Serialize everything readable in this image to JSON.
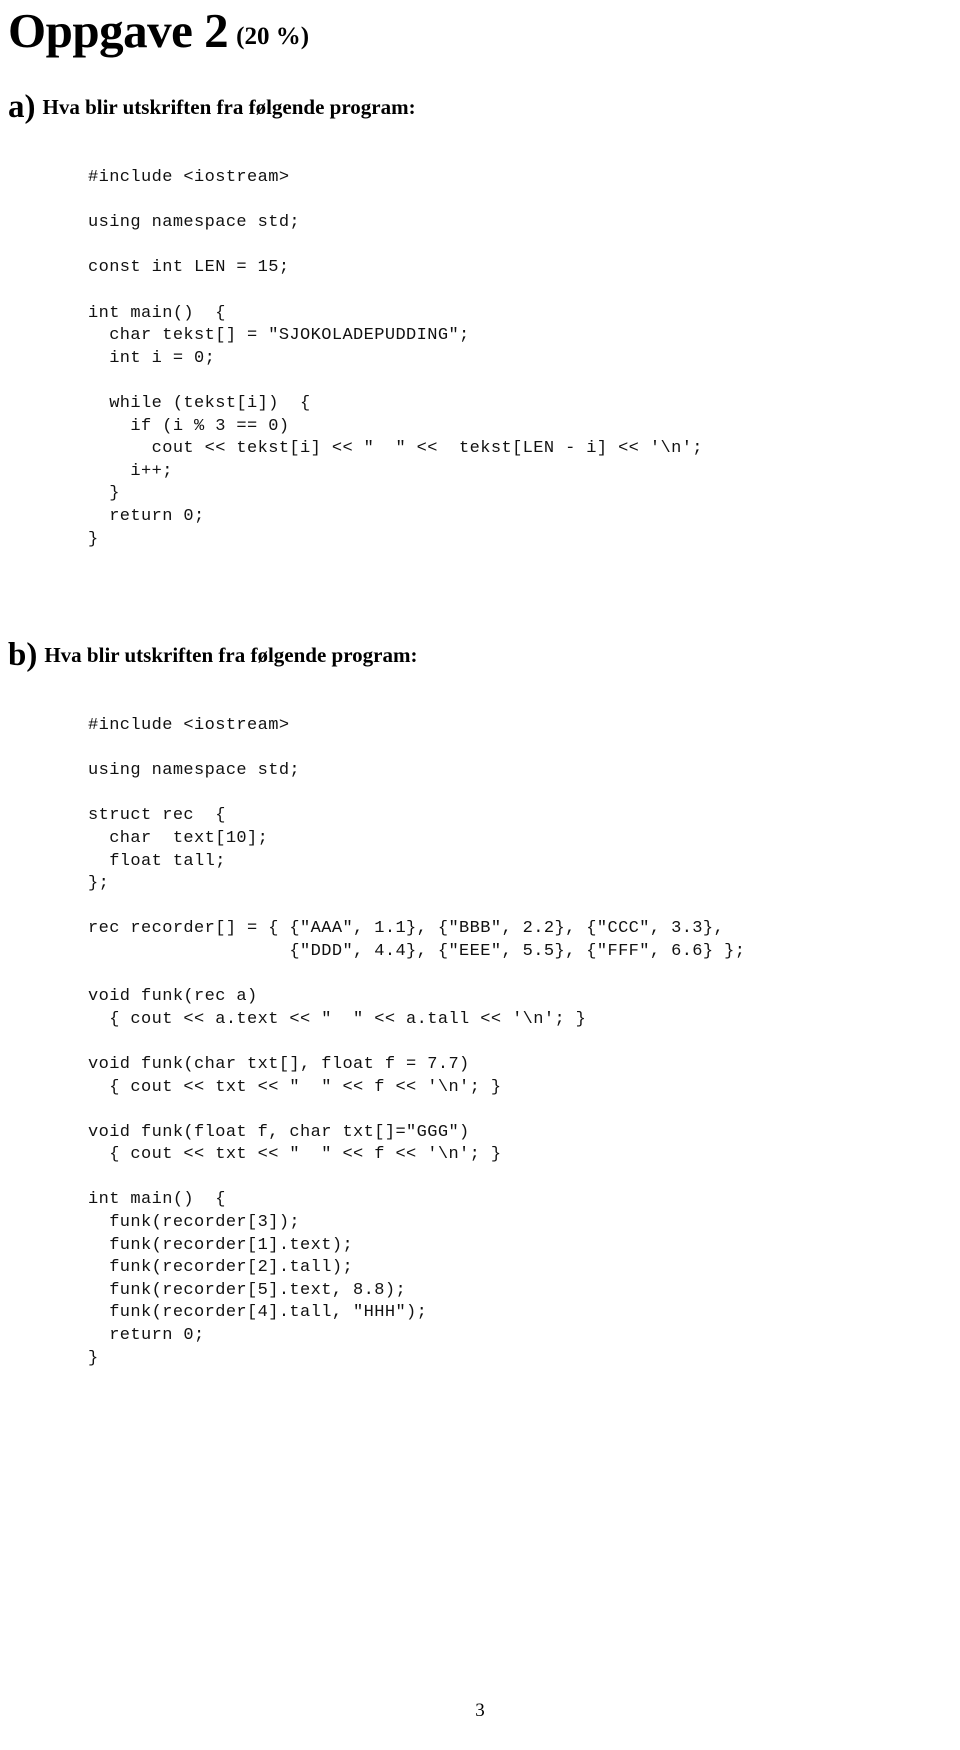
{
  "document": {
    "title": "Oppgave 2",
    "title_percent": "(20 %)",
    "page_number": "3"
  },
  "sections": {
    "a": {
      "letter": "a)",
      "heading": "Hva blir utskriften fra følgende program:",
      "code_lines": [
        "#include <iostream>",
        "",
        "using namespace std;",
        "",
        "const int LEN = 15;",
        "",
        "int main()  {",
        "  char tekst[] = \"SJOKOLADEPUDDING\";",
        "  int i = 0;",
        "",
        "  while (tekst[i])  {",
        "    if (i % 3 == 0)",
        "      cout << tekst[i] << \"  \" <<  tekst[LEN - i] << '\\n';",
        "    i++;",
        "  }",
        "  return 0;",
        "}"
      ],
      "code_text": "#include <iostream>\n\nusing namespace std;\n\nconst int LEN = 15;\n\nint main()  {\n  char tekst[] = \"SJOKOLADEPUDDING\";\n  int i = 0;\n\n  while (tekst[i])  {\n    if (i % 3 == 0)\n      cout << tekst[i] << \"  \" <<  tekst[LEN - i] << '\\n';\n    i++;\n  }\n  return 0;\n}"
    },
    "b": {
      "letter": "b)",
      "heading": "Hva blir utskriften fra følgende program:",
      "code_lines": [
        "#include <iostream>",
        "",
        "using namespace std;",
        "",
        "struct rec  {",
        "  char  text[10];",
        "  float tall;",
        "};",
        "",
        "rec recorder[] = { {\"AAA\", 1.1}, {\"BBB\", 2.2}, {\"CCC\", 3.3},",
        "                   {\"DDD\", 4.4}, {\"EEE\", 5.5}, {\"FFF\", 6.6} };",
        "",
        "void funk(rec a)",
        "  { cout << a.text << \"  \" << a.tall << '\\n'; }",
        "",
        "void funk(char txt[], float f = 7.7)",
        "  { cout << txt << \"  \" << f << '\\n'; }",
        "",
        "void funk(float f, char txt[]=\"GGG\")",
        "  { cout << txt << \"  \" << f << '\\n'; }",
        "",
        "int main()  {",
        "  funk(recorder[3]);",
        "  funk(recorder[1].text);",
        "  funk(recorder[2].tall);",
        "  funk(recorder[5].text, 8.8);",
        "  funk(recorder[4].tall, \"HHH\");",
        "  return 0;",
        "}"
      ],
      "code_text": "#include <iostream>\n\nusing namespace std;\n\nstruct rec  {\n  char  text[10];\n  float tall;\n};\n\nrec recorder[] = { {\"AAA\", 1.1}, {\"BBB\", 2.2}, {\"CCC\", 3.3},\n                   {\"DDD\", 4.4}, {\"EEE\", 5.5}, {\"FFF\", 6.6} };\n\nvoid funk(rec a)\n  { cout << a.text << \"  \" << a.tall << '\\n'; }\n\nvoid funk(char txt[], float f = 7.7)\n  { cout << txt << \"  \" << f << '\\n'; }\n\nvoid funk(float f, char txt[]=\"GGG\")\n  { cout << txt << \"  \" << f << '\\n'; }\n\nint main()  {\n  funk(recorder[3]);\n  funk(recorder[1].text);\n  funk(recorder[2].tall);\n  funk(recorder[5].text, 8.8);\n  funk(recorder[4].tall, \"HHH\");\n  return 0;\n}"
    }
  }
}
